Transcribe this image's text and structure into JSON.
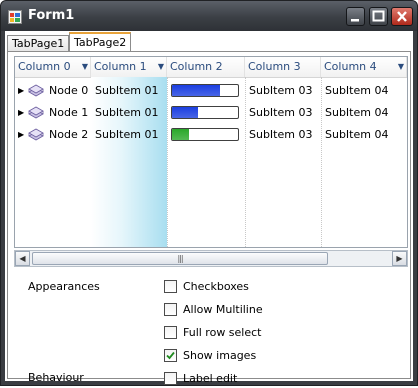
{
  "window": {
    "title": "Form1",
    "colors": {
      "frame": "#3a3d42",
      "accent_tab": "#e8a33a",
      "header_text": "#2b4c7e"
    }
  },
  "tabs": [
    {
      "label": "TabPage1",
      "selected": false
    },
    {
      "label": "TabPage2",
      "selected": true
    }
  ],
  "listview": {
    "columns": [
      "Column 0",
      "Column 1",
      "Column 2",
      "Column 3",
      "Column 4"
    ],
    "rows": [
      {
        "node": "Node 0",
        "sub1": "SubItem 01",
        "progress": 0.72,
        "progress_color": "#1b3fe0",
        "sub3": "SubItem 03",
        "sub4": "SubItem 04",
        "icon": "node-icon"
      },
      {
        "node": "Node 1",
        "sub1": "SubItem 01",
        "progress": 0.4,
        "progress_color": "#1b3fe0",
        "sub3": "SubItem 03",
        "sub4": "SubItem 04",
        "icon": "node-icon"
      },
      {
        "node": "Node 2",
        "sub1": "SubItem 01",
        "progress": 0.25,
        "progress_color": "#2aa82a",
        "sub3": "SubItem 03",
        "sub4": "SubItem 04",
        "icon": "node-icon"
      }
    ],
    "scroll_grip": "|||"
  },
  "options": {
    "appearances_label": "Appearances",
    "behaviour_label": "Behaviour",
    "checkboxes": [
      {
        "label": "Checkboxes",
        "checked": false
      },
      {
        "label": "Allow Multiline",
        "checked": false
      },
      {
        "label": "Full row select",
        "checked": false
      },
      {
        "label": "Show images",
        "checked": true
      },
      {
        "label": "Label edit",
        "checked": false
      }
    ]
  }
}
